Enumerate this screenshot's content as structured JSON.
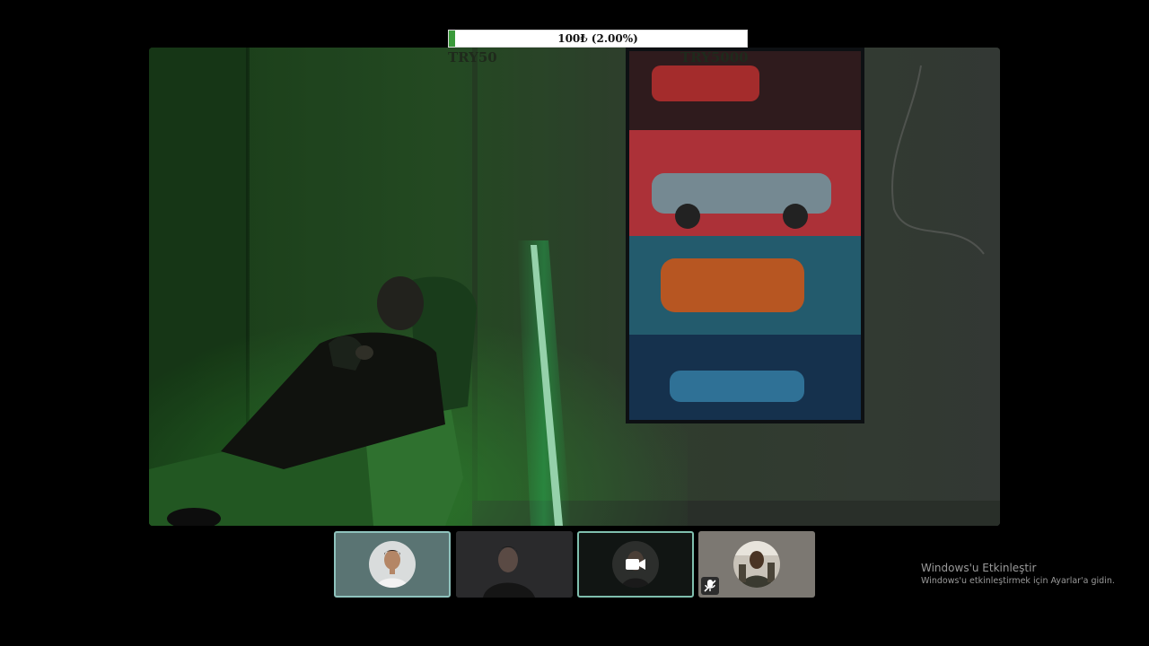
{
  "goal": {
    "current_label": "100₺ (2.00%)",
    "progress_percent": 2.0,
    "min_label": "TRY50",
    "max_label": "TRY5000"
  },
  "thumbnails": [
    {
      "icon": "avatar",
      "active": true
    },
    {
      "icon": "camera-feed",
      "active": false
    },
    {
      "icon": "video-camera-icon",
      "active": true
    },
    {
      "icon": "avatar",
      "muted": true
    }
  ],
  "watermark": {
    "title": "Windows'u Etkinleştir",
    "subtitle": "Windows'u etkinleştirmek için Ayarlar'a gidin."
  },
  "colors": {
    "background": "#000000",
    "goal_fill": "#3a9a3a",
    "active_border": "#8fc3bd",
    "room_green": "#2f6b2f",
    "led_green": "#8dffb8"
  }
}
